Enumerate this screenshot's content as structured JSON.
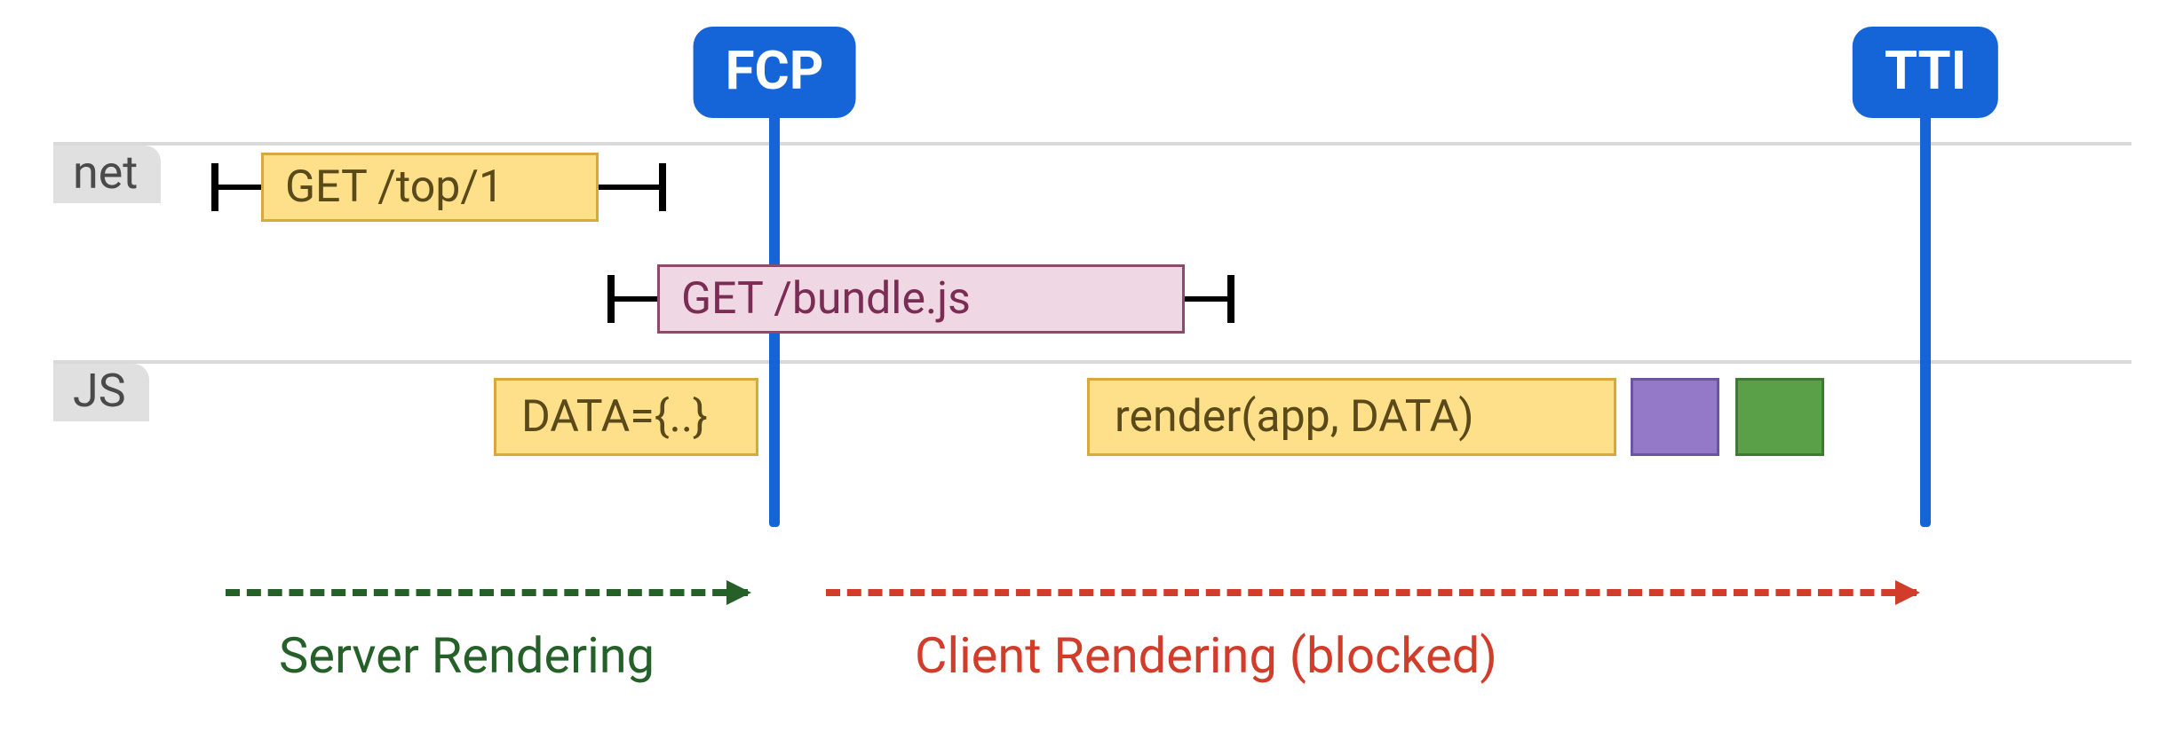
{
  "markers": {
    "fcp": "FCP",
    "tti": "TTI"
  },
  "rows": {
    "net": "net",
    "js": "JS"
  },
  "net": {
    "req_page": "GET /top/1",
    "req_bundle": "GET /bundle.js"
  },
  "js": {
    "data_inline": "DATA={..}",
    "render_call": "render(app, DATA)"
  },
  "phases": {
    "server": "Server Rendering",
    "client": "Client Rendering (blocked)"
  },
  "colors": {
    "marker_blue": "#1565d8",
    "bar_yellow_bg": "#ffe08a",
    "bar_pink_bg": "#efd7e3",
    "chip_purple": "#9579c9",
    "chip_green": "#5aa048",
    "phase_green": "#256029",
    "phase_red": "#d23c2a"
  }
}
